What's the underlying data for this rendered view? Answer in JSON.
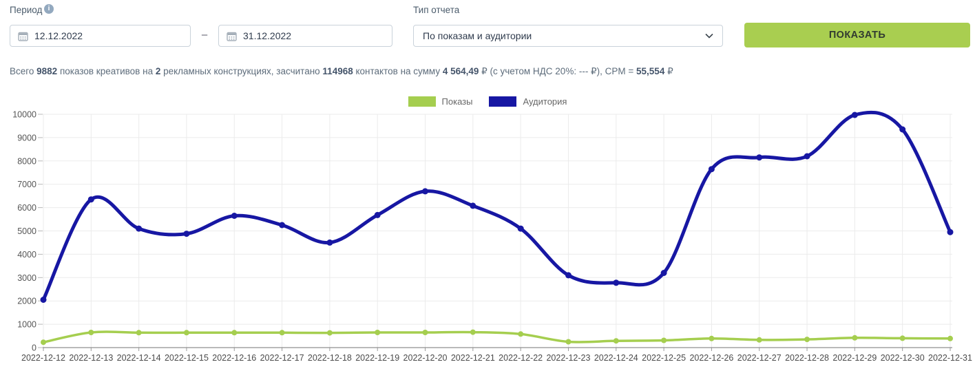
{
  "controls": {
    "period_label": "Период",
    "date_from": "12.12.2022",
    "date_to": "31.12.2022",
    "range_separator": "–",
    "report_type_label": "Тип отчета",
    "report_type_value": "По показам и аудитории",
    "show_button_label": "ПОКАЗАТЬ"
  },
  "summary": {
    "t1": "Всего ",
    "v1": "9882",
    "t2": " показов креативов на ",
    "v2": "2",
    "t3": " рекламных конструкциях, засчитано ",
    "v3": "114968",
    "t4": " контактов на сумму ",
    "v4": "4 564,49",
    "t5": " ₽ (с учетом НДС 20%: --- ₽), CPM = ",
    "v5": "55,554",
    "t6": " ₽"
  },
  "colors": {
    "accent_green": "#a5ce4f",
    "accent_navy": "#1717a3",
    "button_bg": "#a9ce50",
    "grid_line": "#ebebeb"
  },
  "chart_data": {
    "type": "line",
    "title": "",
    "xlabel": "",
    "ylabel": "",
    "ylim": [
      0,
      10000
    ],
    "ytick_step": 1000,
    "grid": true,
    "smooth": true,
    "legend_position": "top-center",
    "x": [
      "2022-12-12",
      "2022-12-13",
      "2022-12-14",
      "2022-12-15",
      "2022-12-16",
      "2022-12-17",
      "2022-12-18",
      "2022-12-19",
      "2022-12-20",
      "2022-12-21",
      "2022-12-22",
      "2022-12-23",
      "2022-12-24",
      "2022-12-25",
      "2022-12-26",
      "2022-12-27",
      "2022-12-28",
      "2022-12-29",
      "2022-12-30",
      "2022-12-31"
    ],
    "series": [
      {
        "name": "Показы",
        "color": "#a5ce4f",
        "line_width": 3.5,
        "point_radius": 4,
        "values": [
          230,
          650,
          640,
          640,
          640,
          640,
          630,
          650,
          650,
          660,
          580,
          250,
          290,
          310,
          390,
          330,
          350,
          420,
          400,
          390
        ]
      },
      {
        "name": "Аудитория",
        "color": "#1717a3",
        "line_width": 5,
        "point_radius": 4.5,
        "values": [
          2050,
          6350,
          5100,
          4880,
          5650,
          5250,
          4500,
          5680,
          6700,
          6080,
          5100,
          3100,
          2780,
          3200,
          7650,
          8150,
          8200,
          9970,
          9350,
          4950
        ]
      }
    ]
  }
}
